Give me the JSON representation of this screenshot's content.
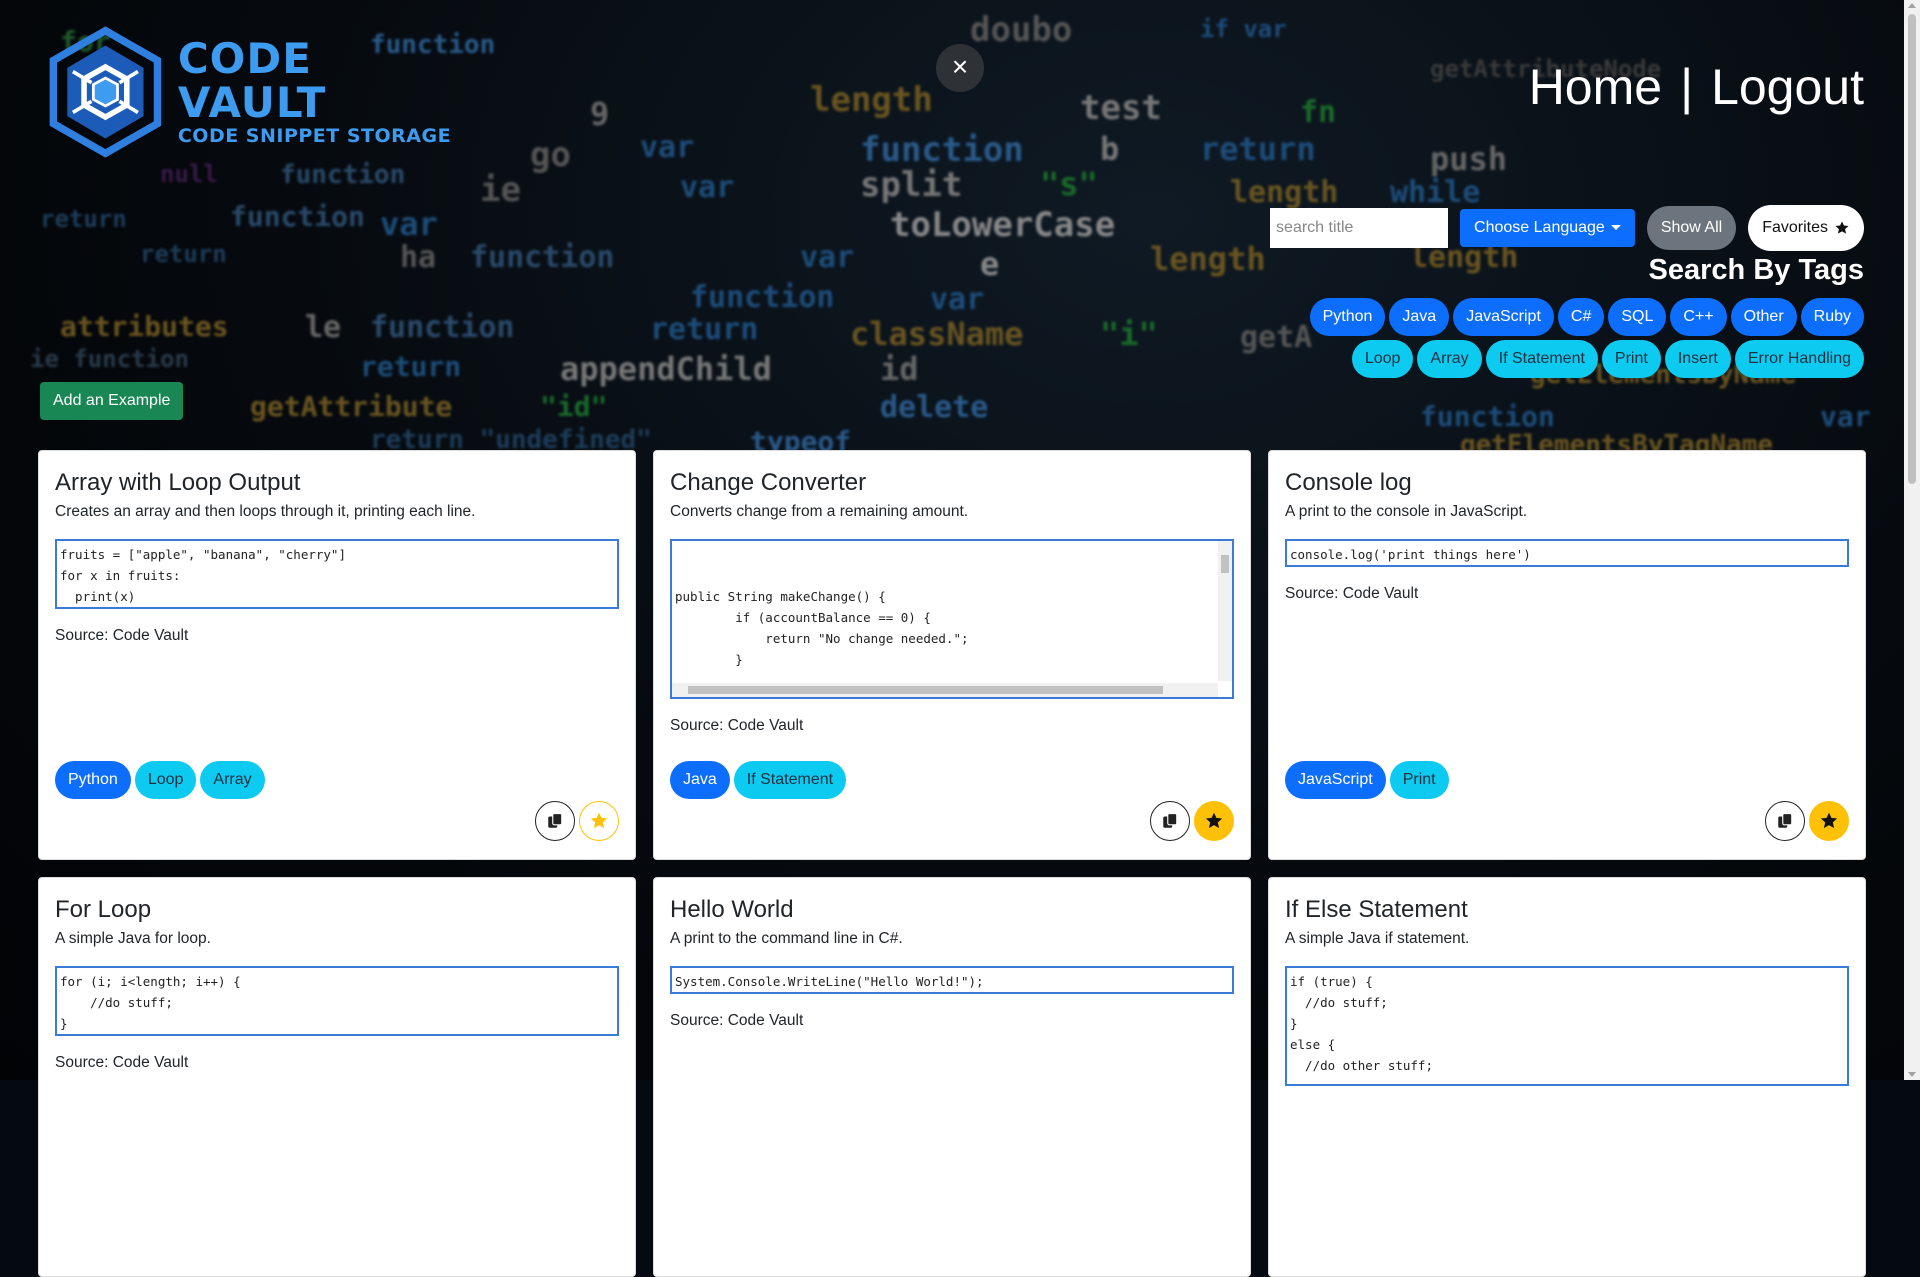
{
  "header": {
    "logo_title": "CODE VAULT",
    "logo_subtitle": "CODE SNIPPET STORAGE",
    "close_label": "×",
    "nav_home": "Home",
    "nav_sep": "|",
    "nav_logout": "Logout"
  },
  "search": {
    "placeholder": "search title",
    "language_button": "Choose Language",
    "show_all": "Show All",
    "favorites": "Favorites"
  },
  "tags": {
    "title": "Search By Tags",
    "row1": [
      "Python",
      "Java",
      "JavaScript",
      "C#",
      "SQL",
      "C++",
      "Other",
      "Ruby"
    ],
    "row2": [
      "Loop",
      "Array",
      "If Statement",
      "Print",
      "Insert",
      "Error Handling"
    ]
  },
  "add_button": "Add an Example",
  "cards": [
    {
      "title": "Array with Loop Output",
      "description": "Creates an array and then loops through it, printing each line.",
      "code": "fruits = [\"apple\", \"banana\", \"cherry\"]\nfor x in fruits:\n  print(x)",
      "source": "Source: Code Vault",
      "tags": [
        {
          "label": "Python",
          "style": "blue"
        },
        {
          "label": "Loop",
          "style": "cyan"
        },
        {
          "label": "Array",
          "style": "cyan"
        }
      ],
      "favorite": false
    },
    {
      "title": "Change Converter",
      "description": "Converts change from a remaining amount.",
      "code": "public String makeChange() {\n        if (accountBalance == 0) {\n            return \"No change needed.\";\n        }\n\n        String changeAmounts = \"\";",
      "source": "Source: Code Vault",
      "tags": [
        {
          "label": "Java",
          "style": "blue"
        },
        {
          "label": "If Statement",
          "style": "cyan"
        }
      ],
      "favorite": true
    },
    {
      "title": "Console log",
      "description": "A print to the console in JavaScript.",
      "code": "console.log('print things here')",
      "source": "Source: Code Vault",
      "tags": [
        {
          "label": "JavaScript",
          "style": "blue"
        },
        {
          "label": "Print",
          "style": "cyan"
        }
      ],
      "favorite": true
    },
    {
      "title": "For Loop",
      "description": "A simple Java for loop.",
      "code": "for (i; i<length; i++) {\n    //do stuff;\n}",
      "source": "Source: Code Vault"
    },
    {
      "title": "Hello World",
      "description": "A print to the command line in C#.",
      "code": "System.Console.WriteLine(\"Hello World!\");",
      "source": "Source: Code Vault"
    },
    {
      "title": "If Else Statement",
      "description": "A simple Java if statement.",
      "code": "if (true) {\n  //do stuff;\n}\nelse {\n  //do other stuff;"
    }
  ],
  "colors": {
    "primary": "#0d6efd",
    "info": "#0dcaf0",
    "success": "#198754",
    "secondary": "#6c757d",
    "warning": "#ffc107",
    "logo": "#3d9bf0"
  }
}
